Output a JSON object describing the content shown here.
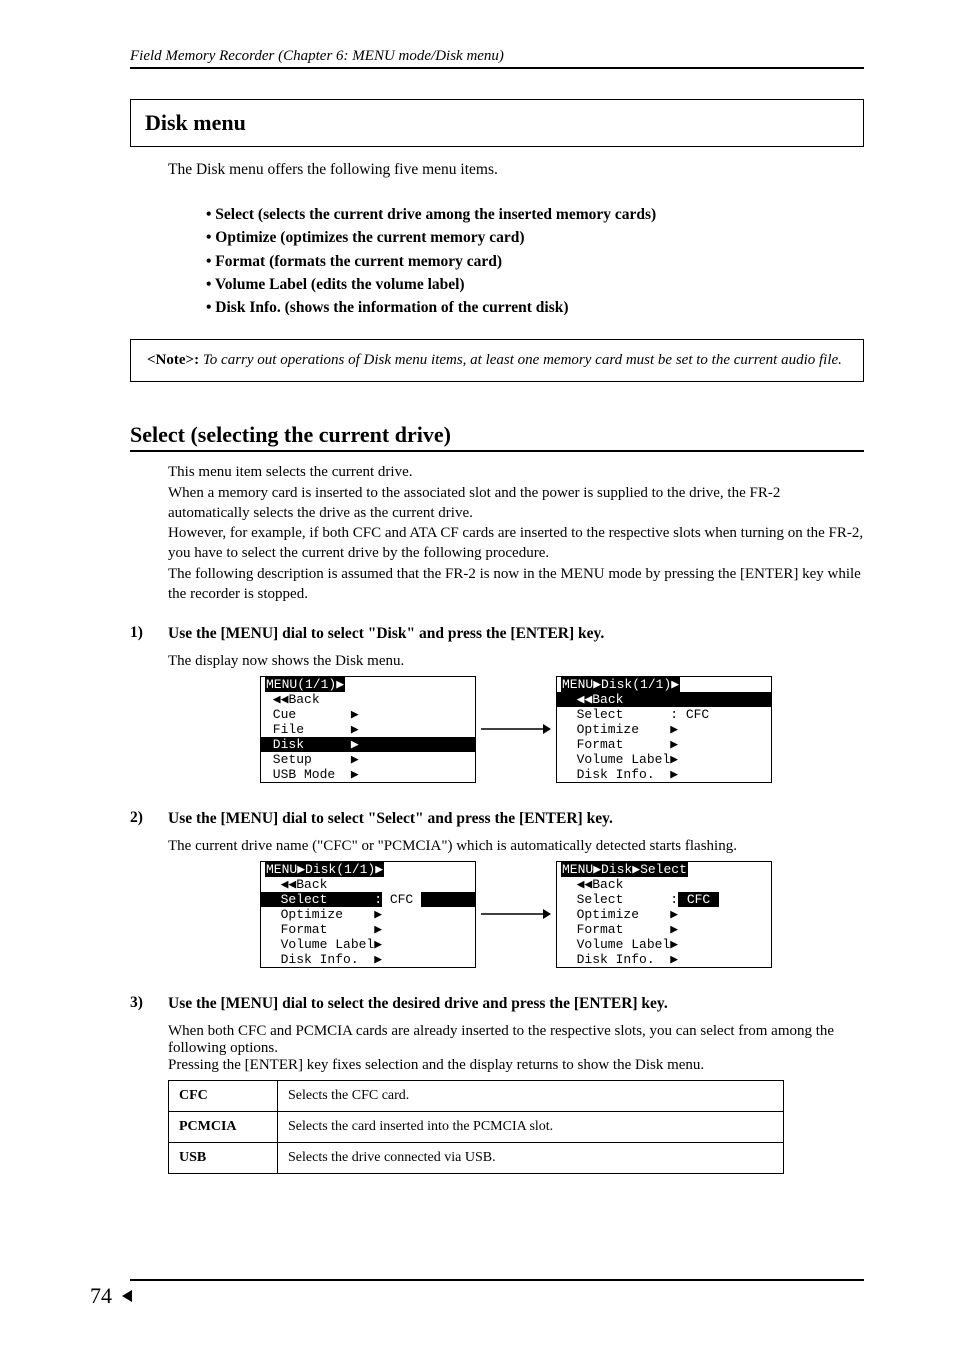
{
  "header": {
    "title": "Field Memory Recorder (Chapter 6: MENU mode/Disk menu)"
  },
  "boxed_heading": "Disk menu",
  "lead": "The Disk menu offers the following five menu items.",
  "bullets": [
    "• Select (selects the current drive among the inserted memory cards)",
    "• Optimize (optimizes the current memory card)",
    "• Format (formats the current memory card)",
    "• Volume Label (edits the volume label)",
    "• Disk Info. (shows the information of the current disk)"
  ],
  "note": {
    "label": "<Note>:",
    "text": " To carry out operations of Disk menu items, at least one memory card must be set to the current audio file."
  },
  "section": {
    "title": "Select (selecting the current drive)",
    "body": "This menu item selects the current drive.\nWhen a memory card is inserted to the associated slot and the power is supplied to the drive, the FR-2 automatically selects the drive as the current drive.\nHowever, for example, if both CFC and ATA CF cards are inserted to the respective slots when turning on the FR-2, you have to select the current drive by the following procedure.\nThe following description is assumed that the FR-2 is now in the MENU mode by pressing the [ENTER] key while the recorder is stopped."
  },
  "steps": [
    {
      "num": "1)",
      "bold": "Use the [MENU] dial to select \"Disk\" and press the [ENTER] key.",
      "sub": "The display now shows the Disk menu."
    },
    {
      "num": "2)",
      "bold": "Use the [MENU] dial to select \"Select\" and press the [ENTER] key.",
      "sub": "The current drive name (\"CFC\" or \"PCMCIA\") which is automatically detected starts flashing."
    },
    {
      "num": "3)",
      "bold": "Use the [MENU] dial to select the desired drive and press the [ENTER] key.",
      "sub": "When both CFC and PCMCIA cards are already inserted to the respective slots, you can select from among the following options.\nPressing the [ENTER] key fixes selection and the display returns to show the Disk menu."
    }
  ],
  "lcd1": {
    "left": {
      "l1": "MENU(1/1)▶",
      "l2": " ◀◀Back",
      "l3": " Cue       ▶",
      "l4": " File      ▶",
      "l5": " Disk      ▶",
      "l6": " Setup     ▶",
      "l7": " USB Mode  ▶"
    },
    "right": {
      "l1": "MENU▶Disk(1/1)▶",
      "l2": "  ◀◀Back",
      "l3": "  Select      : CFC",
      "l4": "  Optimize    ▶",
      "l5": "  Format      ▶",
      "l6": "  Volume Label▶",
      "l7": "  Disk Info.  ▶"
    }
  },
  "lcd2": {
    "left": {
      "l1": "MENU▶Disk(1/1)▶",
      "l2": "  ◀◀Back",
      "l3a": "  Select      :",
      "l3b": " CFC ",
      "l4": "  Optimize    ▶",
      "l5": "  Format      ▶",
      "l6": "  Volume Label▶",
      "l7": "  Disk Info.  ▶"
    },
    "right": {
      "l1": "MENU▶Disk▶Select",
      "l2": "  ◀◀Back",
      "l3a": "  Select      :",
      "l3b": " CFC ",
      "l4": "  Optimize    ▶",
      "l5": "  Format      ▶",
      "l6": "  Volume Label▶",
      "l7": "  Disk Info.  ▶"
    }
  },
  "options": [
    {
      "opt": "CFC",
      "desc": "Selects the CFC card."
    },
    {
      "opt": "PCMCIA",
      "desc": "Selects the card inserted into the PCMCIA slot."
    },
    {
      "opt": "USB",
      "desc": "Selects the drive connected via USB."
    }
  ],
  "page_num": "74"
}
